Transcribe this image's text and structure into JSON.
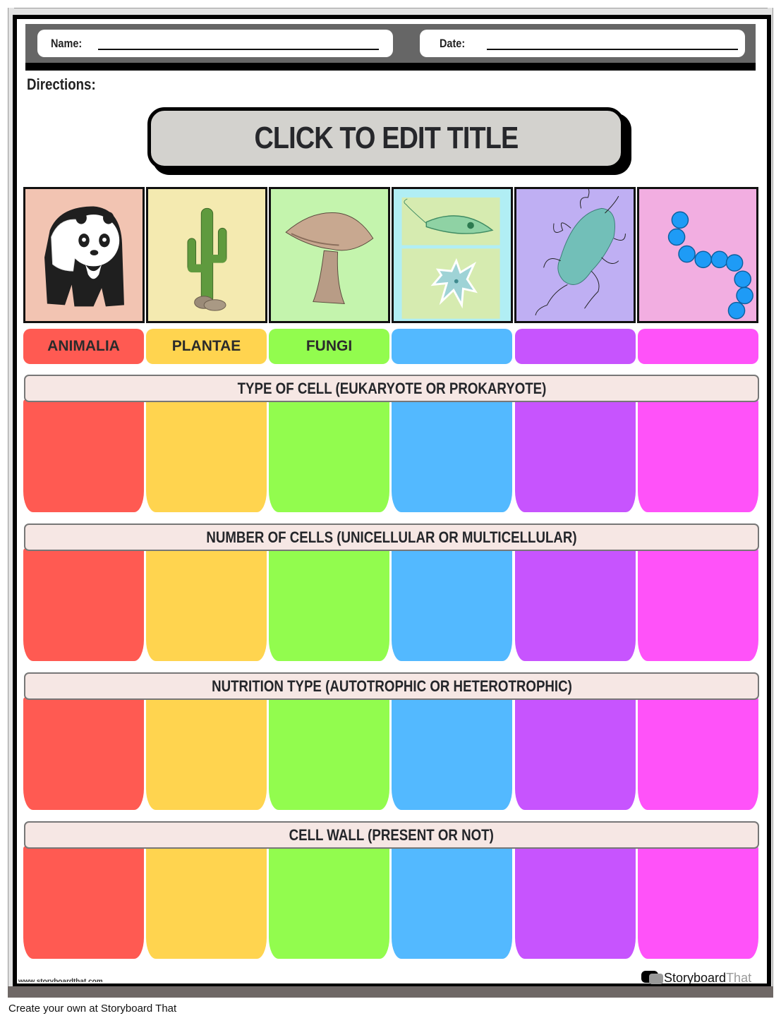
{
  "worksheet": {
    "name_label": "Name:",
    "date_label": "Date:",
    "directions_label": "Directions:",
    "title": "CLICK TO EDIT TITLE"
  },
  "images": [
    {
      "subject": "panda",
      "icon": "panda-icon",
      "bg": "#f2c4b2"
    },
    {
      "subject": "cactus",
      "icon": "cactus-icon",
      "bg": "#f4eab0"
    },
    {
      "subject": "mushroom",
      "icon": "mushroom-icon",
      "bg": "#c4f4ad"
    },
    {
      "subject": "protists",
      "icon": "protist-icon",
      "bg": "#b1eef4"
    },
    {
      "subject": "bacillus bacterium",
      "icon": "bacterium-icon",
      "bg": "#bfaff3"
    },
    {
      "subject": "streptococcus chain",
      "icon": "cocci-chain-icon",
      "bg": "#f2aee1"
    }
  ],
  "kingdoms": [
    {
      "label": "ANIMALIA",
      "color": "#ff5a52"
    },
    {
      "label": "PLANTAE",
      "color": "#ffd44f"
    },
    {
      "label": "FUNGI",
      "color": "#92fc4e"
    },
    {
      "label": "",
      "color": "#53b9ff"
    },
    {
      "label": "",
      "color": "#c754fe"
    },
    {
      "label": "",
      "color": "#ff52f9"
    }
  ],
  "sections": [
    {
      "title": "TYPE OF CELL (EUKARYOTE OR PROKARYOTE)"
    },
    {
      "title": "NUMBER OF CELLS (UNICELLULAR OR MULTICELLULAR)"
    },
    {
      "title": "NUTRITION TYPE (AUTOTROPHIC OR HETEROTROPHIC)"
    },
    {
      "title": "CELL WALL (PRESENT OR NOT)"
    }
  ],
  "footer": {
    "watermark_url": "www.storyboardthat.com",
    "logo_main": "Storyboard",
    "logo_accent": "That",
    "caption": "Create your own at Storyboard That"
  }
}
